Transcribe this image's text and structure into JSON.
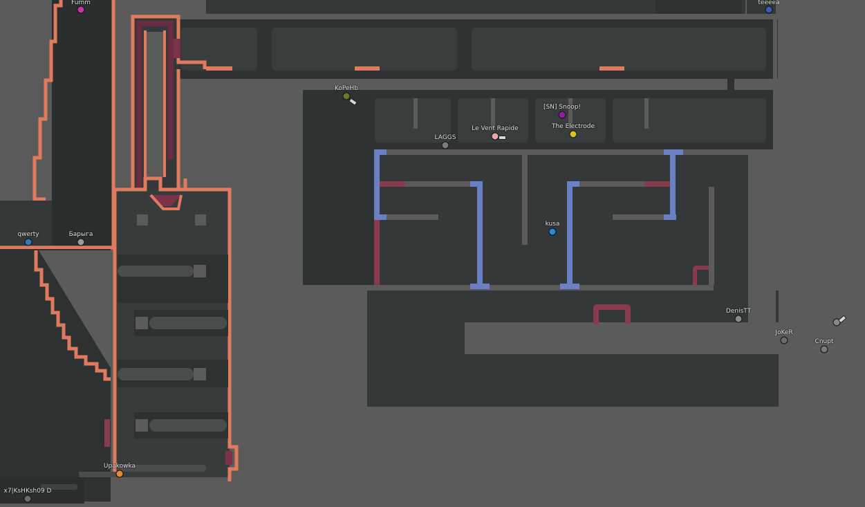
{
  "colors": {
    "floor": "#5b5b5b",
    "solid": "#353838",
    "solid_dark": "#2a2d2d",
    "unhook_edge": "#e07b5d",
    "freeze": "#8a3a4d",
    "blue_tile": "#6a80c4",
    "player_outline": "#111111"
  },
  "players": [
    {
      "name": "Fumm",
      "color": "#c23aa0"
    },
    {
      "name": "qwerty",
      "color": "#2c7bc0"
    },
    {
      "name": "Барыга",
      "color": "#9a9a9a"
    },
    {
      "name": "KoPeHb",
      "color": "#6b7a2a"
    },
    {
      "name": "LAGGS",
      "color": "#7a7a7a"
    },
    {
      "name": "Le Vent Rapide",
      "color": "#e8a8a8"
    },
    {
      "name": "[SN] Snoop!",
      "color": "#9020a0"
    },
    {
      "name": "The Electrode",
      "color": "#d8c020"
    },
    {
      "name": "kusa",
      "color": "#2a8ad0"
    },
    {
      "name": "DenisTT",
      "color": "#8a8a8a"
    },
    {
      "name": "JoKeR",
      "color": "#6a6a6a"
    },
    {
      "name": "Cnupt",
      "color": "#7a7a7a"
    },
    {
      "name": "Upakowka",
      "color": "#e08a3a"
    },
    {
      "name": "x7|KsHKsh09 D",
      "color": "#6a6a6a"
    },
    {
      "name": "teeeea",
      "color": "#3a5ab0"
    }
  ]
}
